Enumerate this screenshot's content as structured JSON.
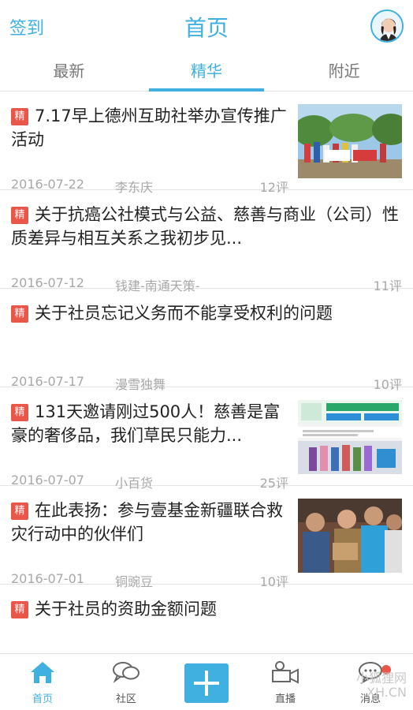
{
  "header": {
    "checkin": "签到",
    "title": "首页",
    "avatar_icon": "user-avatar-icon"
  },
  "tabs": [
    {
      "label": "最新",
      "active": false
    },
    {
      "label": "精华",
      "active": true
    },
    {
      "label": "附近",
      "active": false
    }
  ],
  "badge_label": "精",
  "posts": [
    {
      "title": "7.17早上德州互助社举办宣传推广活动",
      "date": "2016-07-22",
      "author": "李东庆",
      "comments": "12评",
      "thumb": "group-photo"
    },
    {
      "title": "关于抗癌公社模式与公益、慈善与商业（公司）性质差异与相互关系之我初步见...",
      "date": "2016-07-12",
      "author": "钱建-南通天策-",
      "comments": "11评"
    },
    {
      "title": "关于社员忘记义务而不能享受权利的问题",
      "date": "2016-07-17",
      "author": "漫雪独舞",
      "comments": "10评"
    },
    {
      "title": "131天邀请刚过500人！慈善是富豪的奢侈品，我们草民只能力...",
      "date": "2016-07-07",
      "author": "小百货",
      "comments": "25评",
      "thumb": "poster-collage"
    },
    {
      "title": "在此表扬：参与壹基金新疆联合救灾行动中的伙伴们",
      "date": "2016-07-01",
      "author": "铜豌豆",
      "comments": "10评",
      "thumb": "people-photo"
    },
    {
      "title": "关于社员的资助金额问题"
    }
  ],
  "nav": {
    "home": "首页",
    "community": "社区",
    "live": "直播",
    "messages": "消息"
  },
  "watermark": {
    "line1": "小狐狸网",
    "line2": "XH.CN"
  },
  "colors": {
    "accent": "#3fb0e0",
    "badge": "#e9564a"
  }
}
